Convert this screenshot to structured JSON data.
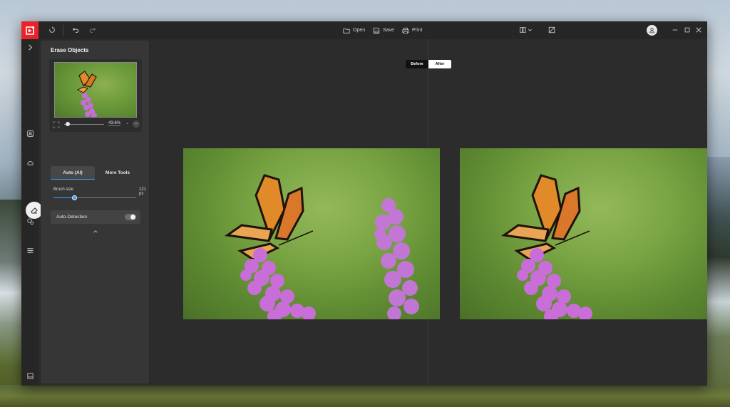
{
  "toolbar": {
    "open_label": "Open",
    "save_label": "Save",
    "print_label": "Print"
  },
  "panel": {
    "title": "Erase Objects",
    "zoom_value": "43.6%",
    "tabs": [
      {
        "label": "Auto (AI)",
        "active": true
      },
      {
        "label": "More Tools",
        "active": false
      }
    ],
    "brush": {
      "label": "Brush size",
      "value": "121 px",
      "fraction": 0.25
    },
    "auto_detection": {
      "label": "Auto-Detection",
      "enabled": false
    }
  },
  "canvas": {
    "before_label": "Before",
    "after_label": "After"
  },
  "icons": {
    "accent": "#3d9cff",
    "logo": "#e8232a"
  }
}
